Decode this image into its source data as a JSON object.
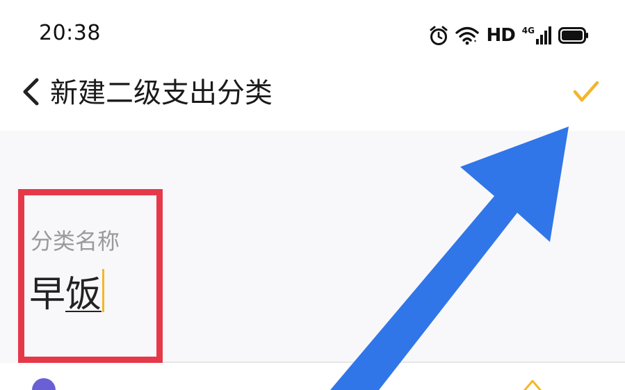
{
  "status_bar": {
    "time": "20:38",
    "network_label": "HD",
    "network_type": "4G",
    "icons": [
      "alarm-icon",
      "wifi-icon",
      "cellular-signal-icon",
      "battery-icon"
    ]
  },
  "header": {
    "title": "新建二级支出分类",
    "back_icon": "chevron-left-icon",
    "confirm_icon": "checkmark-icon",
    "confirm_color": "#f3b62a"
  },
  "form": {
    "name_field": {
      "label": "分类名称",
      "value_committed": "早",
      "value_composing": "饭"
    }
  },
  "annotations": {
    "highlight_color": "#e5394a",
    "arrow_color": "#3176e8"
  }
}
